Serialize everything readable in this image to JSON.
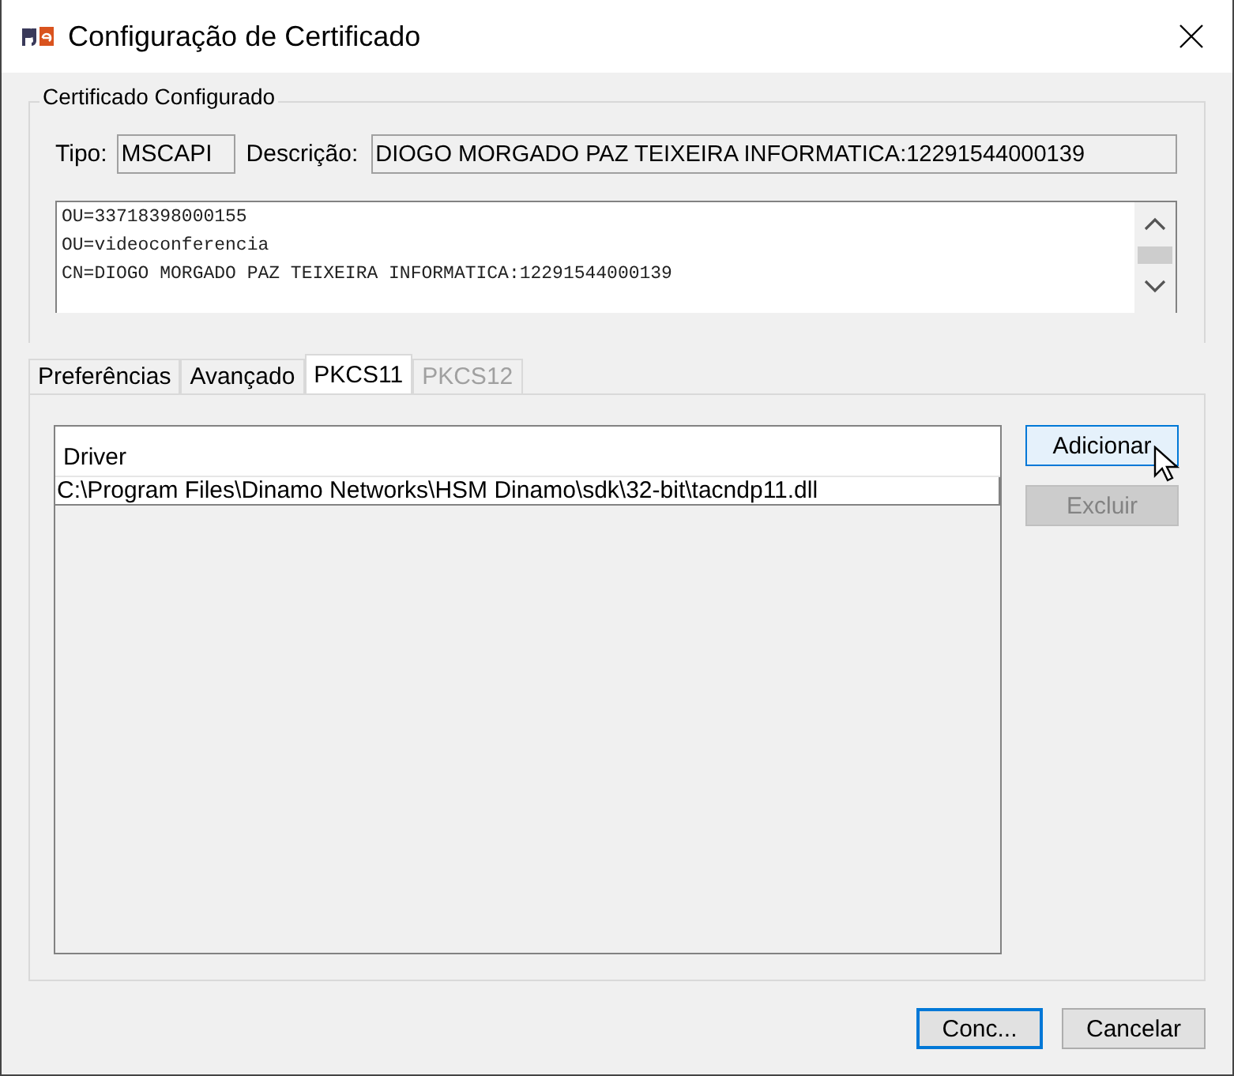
{
  "window": {
    "title": "Configuração de Certificado"
  },
  "certificate_group": {
    "title": "Certificado Configurado",
    "type_label": "Tipo:",
    "type_value": "MSCAPI",
    "description_label": "Descrição:",
    "description_value": "DIOGO MORGADO PAZ TEIXEIRA INFORMATICA:12291544000139",
    "details": [
      "OU=33718398000155",
      "OU=videoconferencia",
      "CN=DIOGO MORGADO PAZ TEIXEIRA INFORMATICA:12291544000139"
    ]
  },
  "tabs": [
    {
      "label": "Preferências",
      "selected": false,
      "disabled": false
    },
    {
      "label": "Avançado",
      "selected": false,
      "disabled": false
    },
    {
      "label": "PKCS11",
      "selected": true,
      "disabled": false
    },
    {
      "label": "PKCS12",
      "selected": false,
      "disabled": true
    }
  ],
  "driver_list": {
    "header": "Driver",
    "rows": [
      "C:\\Program Files\\Dinamo Networks\\HSM Dinamo\\sdk\\32-bit\\tacndp11.dll"
    ]
  },
  "side_buttons": [
    {
      "label": "Adicionar",
      "disabled": false,
      "hovered": true
    },
    {
      "label": "Excluir",
      "disabled": true,
      "hovered": false
    }
  ],
  "footer_buttons": [
    {
      "label": "Conc...",
      "default": true
    },
    {
      "label": "Cancelar",
      "default": false
    }
  ]
}
